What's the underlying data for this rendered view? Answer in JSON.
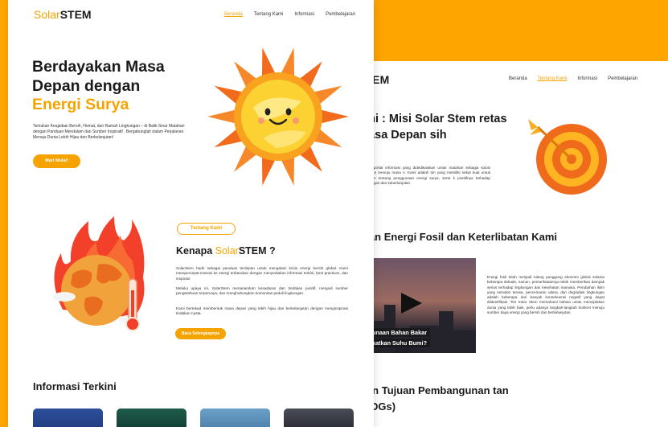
{
  "colors": {
    "accent": "#f5a300",
    "background": "#ffa500",
    "text": "#1a1a1a"
  },
  "front": {
    "logo": {
      "part1": "Solar",
      "part2": "STEM"
    },
    "nav": [
      "Beranda",
      "Tentang Kami",
      "Informasi",
      "Pembelajaran"
    ],
    "hero": {
      "line1": "Berdayakan Masa",
      "line2": "Depan dengan",
      "accent": "Energi Surya",
      "text": "Temukan Keajaiban Bersih, Hemat, dan Ramah Lingkungan – di Balik Sinar Matahari dengan Panduan Mendalam dan Sumber Inspiratif . Bergabunglah dalam Perjalanan Menuju Dunia Lebih Hijau dan Berkelanjutan!",
      "cta": "Mari Mulai!"
    },
    "about": {
      "pill": "Tentang Kami",
      "title_pre": "Kenapa ",
      "title_accent": "Solar",
      "title_post": "STEM ?",
      "p1": "SolarStem hadir sebagai panduan terdepan untuk mengatasi krisis energi bersih global. Kami mempercepat transisi ke energi terbarukan dengan menyediakan informasi terkini, best practices, dan inspirasi.",
      "p2": "Melalui upaya ini, SolarStem menanamkan kesadaran dan tindakan positif, menjadi sumber pengetahuan terpercaya, dan menghubungkan komunitas peduli lingkungan.",
      "p3": "Kami bertekad membentuk masa depan yang lebih hijau dan berkelanjutan dengan menginspirasi tindakan nyata.",
      "cta": "Baca Selengkapnya"
    },
    "info_title": "Informasi Terkini"
  },
  "back": {
    "logo": "EM",
    "nav": [
      "Beranda",
      "Tentang Kami",
      "Informasi",
      "Pembelajaran"
    ],
    "mission_title": "ami : Misi Solar Stem retas Masa Depan sih",
    "mission_text": "Stem, portal informasi yang didedikasikan untuk matahari sebagai solusi terdepan menuju masa n. Kami adalah tim yang memiliki sekat kuat untuk endalam tentang penggunaan energi surya, serta k positifnya terhadap lingkungan dan keberlanjutan",
    "fossil_title": "han Energi Fosil dan Keterlibatan Kami",
    "video_caption1": "ggunaan Bahan Bakar",
    "video_caption2": "ngkatkan Suhu Bumi?",
    "fossil_text": "Energi fosil telah menjadi tulang punggung ekonomi global selama beberapa dekade, namun, pemanfaatannya telah memberikan dampak serius terhadap lingkungan dan kesehatan manusia. Perubahan iklim yang semakin terasa, pencemaran udara, dan degradasi lingkungan adalah beberapa dari banyak konsekuensi negatif yang dapat diidentifikasi. Tim Solar Stem memahami bahwa untuk menciptakan dunia yang lebih baik, perlu adanya langkah-langkah konkret menuju sumber daya energi yang bersih dan berkelanjutan.",
    "sdg_title": "gan Tujuan Pembangunan tan (SDGs)"
  }
}
